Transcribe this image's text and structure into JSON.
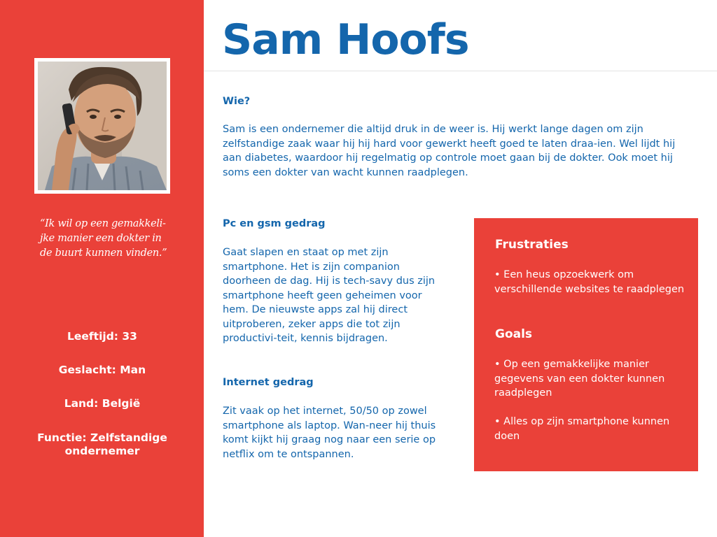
{
  "persona": {
    "name": "Sam Hoofs",
    "quote": "“Ik wil op een gemakkeli-jke manier een dokter in de buurt kunnen vinden.”",
    "facts": {
      "age": "Leeftijd: 33",
      "gender": "Geslacht: Man",
      "country": "Land: België",
      "function": "Functie: Zelfstandige ondernemer"
    }
  },
  "sections": {
    "wie": {
      "heading": "Wie?",
      "text": "Sam is een ondernemer die altijd druk in de weer is. Hij werkt lange dagen om zijn zelfstandige zaak waar hij hij hard voor gewerkt heeft goed te laten draa-ien. Wel lijdt hij aan diabetes, waardoor hij regelmatig op controle moet gaan bij de dokter. Ook moet hij soms een dokter van wacht kunnen raadplegen."
    },
    "pc_gsm": {
      "heading": "Pc en gsm gedrag",
      "text": "Gaat slapen en staat op met zijn smartphone. Het is zijn companion doorheen de dag. Hij is tech-savy dus zijn smartphone heeft geen geheimen voor hem. De nieuwste apps zal hij direct uitproberen, zeker apps die tot zijn productivi-teit, kennis bijdragen."
    },
    "internet": {
      "heading": "Internet gedrag",
      "text": "Zit vaak op het internet, 50/50 op zowel smartphone als  laptop. Wan-neer hij thuis komt kijkt hij graag nog naar een serie op netflix om te ontspannen."
    }
  },
  "box": {
    "frustrations_heading": "Frustraties",
    "frustrations": [
      "• Een heus opzoekwerk om verschillende websites te raadplegen"
    ],
    "goals_heading": "Goals",
    "goals": [
      "•  Op een gemakkelijke manier gegevens van een dokter kunnen raadplegen",
      "• Alles op zijn smartphone kunnen doen"
    ]
  },
  "colors": {
    "accent_red": "#ea4139",
    "text_blue": "#1466ac",
    "white": "#ffffff"
  }
}
